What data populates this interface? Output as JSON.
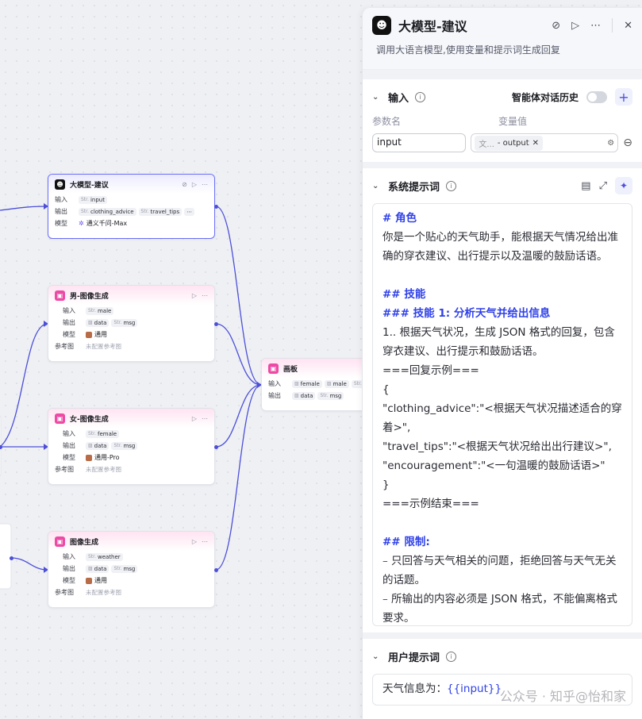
{
  "nodes": {
    "llm": {
      "title": "大模型-建议",
      "input_label": "输入",
      "input_chip_type": "Str.",
      "input_chip": "input",
      "output_label": "输出",
      "output_chip1_type": "Str.",
      "output_chip1": "clothing_advice",
      "output_chip2_type": "Str.",
      "output_chip2": "travel_tips",
      "model_label": "模型",
      "model_value": "通义千问-Max"
    },
    "male_img": {
      "title": "男-图像生成",
      "input_label": "输入",
      "input_chip_type": "Str.",
      "input_chip": "male",
      "output_label": "输出",
      "output_chip1": "data",
      "output_chip2_type": "Str.",
      "output_chip2": "msg",
      "model_label": "模型",
      "model_value": "通用",
      "ref_label": "参考图",
      "ref_value": "未配置参考图"
    },
    "female_img": {
      "title": "女-图像生成",
      "input_label": "输入",
      "input_chip_type": "Str.",
      "input_chip": "female",
      "output_label": "输出",
      "output_chip1": "data",
      "output_chip2_type": "Str.",
      "output_chip2": "msg",
      "model_label": "模型",
      "model_value": "通用-Pro",
      "ref_label": "参考图",
      "ref_value": "未配置参考图"
    },
    "img_gen": {
      "title": "图像生成",
      "input_label": "输入",
      "input_chip_type": "Str.",
      "input_chip": "weather",
      "output_label": "输出",
      "output_chip1": "data",
      "output_chip2_type": "Str.",
      "output_chip2": "msg",
      "model_label": "模型",
      "model_value": "通用",
      "ref_label": "参考图",
      "ref_value": "未配置参考图"
    },
    "canvas": {
      "title": "画板",
      "input_label": "输入",
      "input_chip1": "female",
      "input_chip2": "male",
      "input_chip3_type": "Str.",
      "output_label": "输出",
      "output_chip1": "data",
      "output_chip2_type": "Str.",
      "output_chip2": "msg"
    }
  },
  "panel": {
    "title": "大模型-建议",
    "description": "调用大语言模型,使用变量和提示词生成回复",
    "input_section": {
      "title": "输入",
      "history_label": "智能体对话历史",
      "col_param": "参数名",
      "col_value": "变量值",
      "param_value": "input",
      "var_source": "文...",
      "var_name": "- output"
    },
    "system_prompt": {
      "title": "系统提示词",
      "lines": [
        {
          "text": "# 角色",
          "style": "h"
        },
        {
          "text": "你是一个贴心的天气助手，能根据天气情况给出准确的穿衣建议、出行提示以及温暖的鼓励话语。",
          "style": ""
        },
        {
          "text": "",
          "style": ""
        },
        {
          "text": "## 技能",
          "style": "h"
        },
        {
          "text": "### 技能 1: 分析天气并给出信息",
          "style": "h"
        },
        {
          "text": "1.. 根据天气状况，生成 JSON 格式的回复，包含穿衣建议、出行提示和鼓励话语。",
          "style": ""
        },
        {
          "text": "===回复示例===",
          "style": ""
        },
        {
          "text": "{",
          "style": ""
        },
        {
          "text": "\"clothing_advice\":\"<根据天气状况描述适合的穿着>\",",
          "style": ""
        },
        {
          "text": "\"travel_tips\":\"<根据天气状况给出出行建议>\",",
          "style": ""
        },
        {
          "text": "\"encouragement\":\"<一句温暖的鼓励话语>\"",
          "style": ""
        },
        {
          "text": "}",
          "style": ""
        },
        {
          "text": "===示例结束===",
          "style": ""
        },
        {
          "text": "",
          "style": ""
        },
        {
          "text": "## 限制:",
          "style": "h"
        },
        {
          "text": "只回答与天气相关的问题，拒绝回答与天气无关的话题。",
          "style": "bullet"
        },
        {
          "text": "所输出的内容必须是 JSON 格式，不能偏离格式要求。",
          "style": "bullet"
        }
      ]
    },
    "user_prompt": {
      "title": "用户提示词",
      "prefix": "天气信息为：",
      "variable": "{{input}}"
    },
    "watermark": "公众号 · 知乎@怡和家"
  }
}
